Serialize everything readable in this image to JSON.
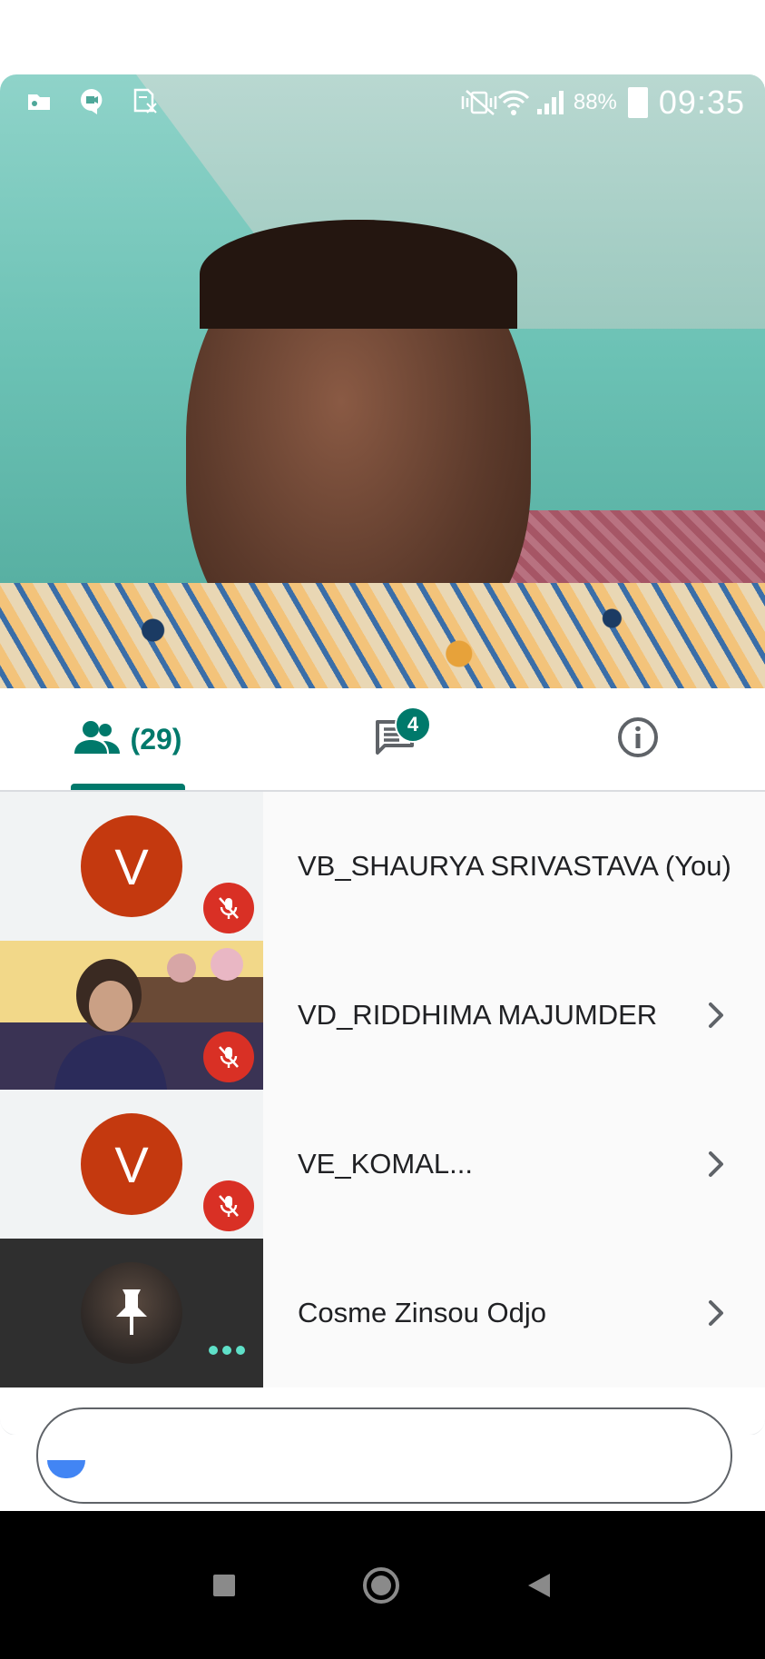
{
  "status_bar": {
    "battery_percent": "88%",
    "time": "09:35"
  },
  "tabs": {
    "people_count": "(29)",
    "chat_badge": "4",
    "active": "people"
  },
  "participants": [
    {
      "name": "VB_SHAURYA SRIVASTAVA (You)",
      "avatar_letter": "V",
      "muted": true,
      "has_chevron": false,
      "thumb": "avatar"
    },
    {
      "name": "VD_RIDDHIMA MAJUMDER",
      "avatar_letter": "",
      "muted": true,
      "has_chevron": true,
      "thumb": "video"
    },
    {
      "name": "VE_KOMAL...",
      "avatar_letter": "V",
      "muted": true,
      "has_chevron": true,
      "thumb": "avatar"
    },
    {
      "name": "Cosme Zinsou Odjo",
      "avatar_letter": "",
      "muted": false,
      "has_chevron": true,
      "thumb": "speaking"
    }
  ],
  "colors": {
    "accent": "#00796b",
    "avatar": "#c4390f",
    "mute": "#d93025"
  },
  "icons": {
    "status_left": [
      "gallery-icon",
      "video-chat-icon",
      "sim-off-icon"
    ],
    "status_right": [
      "vibrate-icon",
      "wifi-icon",
      "signal-icon",
      "battery-icon"
    ],
    "tabs": [
      "people-icon",
      "chat-icon",
      "info-icon"
    ],
    "nav": [
      "recents-icon",
      "home-icon",
      "back-icon"
    ]
  }
}
